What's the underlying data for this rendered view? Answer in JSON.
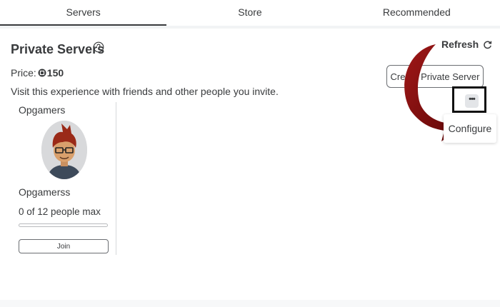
{
  "tabs": [
    {
      "label": "Servers",
      "active": true
    },
    {
      "label": "Store",
      "active": false
    },
    {
      "label": "Recommended",
      "active": false
    }
  ],
  "private_servers": {
    "title": "Private Servers",
    "help_icon": "question-circle-icon",
    "refresh_label": "Refresh",
    "refresh_icon": "refresh-icon",
    "price_label": "Price:",
    "price_icon": "robux-icon",
    "price_amount": "150",
    "description": "Visit this experience with friends and other people you invite.",
    "create_button": "Create Private Server"
  },
  "server": {
    "owner": "Opgamers",
    "name": "Opgamerss",
    "capacity_text": "0 of 12 people max",
    "capacity_fraction": 0,
    "join_label": "Join",
    "more_icon": "more-dots-icon",
    "menu_item": "Configure"
  },
  "colors": {
    "text": "#393b3d",
    "arrow": "#8b1010",
    "tab_indicator": "#393b3d"
  }
}
